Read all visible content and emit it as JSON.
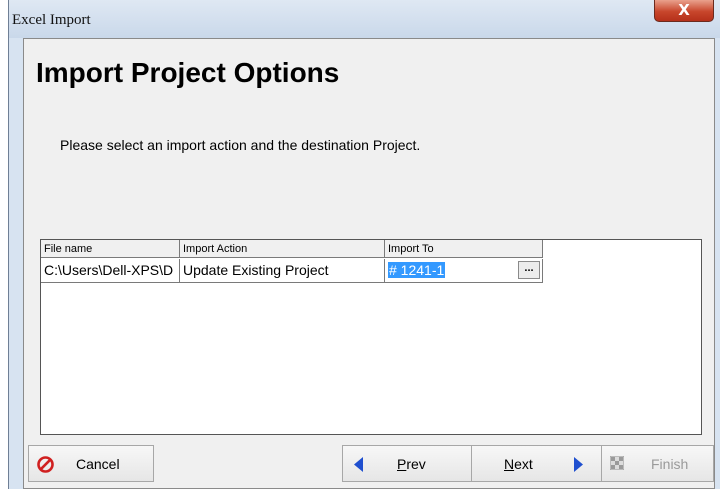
{
  "window": {
    "title": "Excel Import",
    "close_glyph": "X"
  },
  "page": {
    "heading": "Import Project Options",
    "instruction": "Please select an import action and the destination Project."
  },
  "grid": {
    "columns": [
      "File name",
      "Import Action",
      "Import To"
    ],
    "rows": [
      {
        "file_name": "C:\\Users\\Dell-XPS\\D",
        "import_action": "Update Existing Project",
        "import_to": "# 1241-1"
      }
    ],
    "browse_label": "..."
  },
  "buttons": {
    "cancel": {
      "label": "Cancel",
      "icon": "cancel-icon"
    },
    "prev": {
      "label_first": "P",
      "label_rest": "rev",
      "icon": "arrow-left-icon"
    },
    "next": {
      "label_first": "N",
      "label_rest": "ext",
      "icon": "arrow-right-icon"
    },
    "finish": {
      "label": "Finish",
      "icon": "checkered-flag-icon",
      "enabled": false
    }
  },
  "colors": {
    "accent": "#1f4fcf",
    "cancel_red": "#d02020",
    "selection": "#3399ff"
  }
}
